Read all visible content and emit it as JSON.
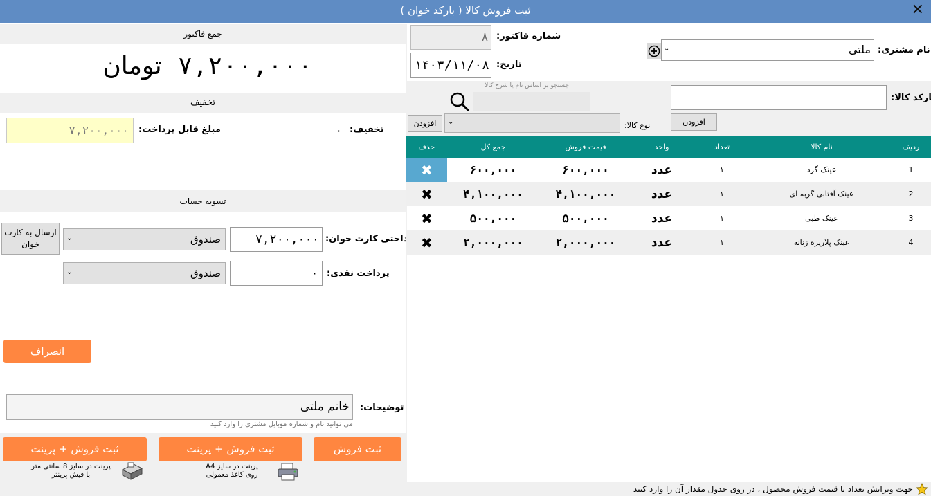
{
  "window": {
    "title": "ثبت فروش کالا ( بارکد خوان )",
    "close_glyph": "✕"
  },
  "invoice": {
    "total_section_title": "جمع فاکتور",
    "total_amount": "۷,۲۰۰,۰۰۰",
    "currency": "تومان",
    "invoice_number_label": "شماره فاکتور:",
    "invoice_number": "۸",
    "date_label": "تاریخ:",
    "date": "۱۴۰۳/۱۱/۰۸"
  },
  "discount": {
    "section_title": "تخفیف",
    "discount_label": "تخفیف:",
    "discount_value": "۰",
    "payable_label": "مبلغ قابل پرداخت:",
    "payable_value": "۷,۲۰۰,۰۰۰"
  },
  "settlement": {
    "section_title": "تسویه حساب",
    "card_label": "پرداختی کارت خوان:",
    "card_value": "۷,۲۰۰,۰۰۰",
    "card_account": "صندوق",
    "send_to_card_reader": "ارسال به کارت خوان",
    "cash_label": "پرداخت نقدی:",
    "cash_value": "۰",
    "cash_account": "صندوق"
  },
  "actions": {
    "cancel": "انصراف",
    "save": "ثبت فروش",
    "save_print_a4": "ثبت فروش + پرینت",
    "save_print_receipt": "ثبت فروش + پرینت",
    "a4_hint_line1": "پرینت در سایز A4",
    "a4_hint_line2": "روی کاغذ معمولی",
    "receipt_hint_line1": "پرینت در سایز 8 سانتی متر",
    "receipt_hint_line2": "با فیش پرینتر"
  },
  "notes": {
    "label": "توضیحات:",
    "value": "خانم ملتی",
    "hint": "می توانید نام و شماره موبایل مشتری را وارد کنید"
  },
  "customer": {
    "label": "نام مشتری:",
    "value": "ملتی"
  },
  "barcode": {
    "label": "بارکد کالا:",
    "value": "",
    "add_button": "افزودن",
    "search_placeholder": "جستجو بر اساس نام یا شرح کالا",
    "category_label": "نوع کالا:",
    "category_value": "",
    "category_add_button": "افزودن"
  },
  "table": {
    "headers": [
      "ردیف",
      "نام کالا",
      "تعداد",
      "واحد",
      "قیمت فروش",
      "جمع کل",
      "حذف"
    ],
    "rows": [
      {
        "row": "1",
        "name": "عینک گرد",
        "qty": "۱",
        "unit": "عدد",
        "price": "۶۰۰,۰۰۰",
        "total": "۶۰۰,۰۰۰",
        "del": "✖"
      },
      {
        "row": "2",
        "name": "عینک آفتابی گربه ای",
        "qty": "۱",
        "unit": "عدد",
        "price": "۴,۱۰۰,۰۰۰",
        "total": "۴,۱۰۰,۰۰۰",
        "del": "✖"
      },
      {
        "row": "3",
        "name": "عینک طبی",
        "qty": "۱",
        "unit": "عدد",
        "price": "۵۰۰,۰۰۰",
        "total": "۵۰۰,۰۰۰",
        "del": "✖"
      },
      {
        "row": "4",
        "name": "عینک پلاریزه زنانه",
        "qty": "۱",
        "unit": "عدد",
        "price": "۲,۰۰۰,۰۰۰",
        "total": "۲,۰۰۰,۰۰۰",
        "del": "✖"
      }
    ]
  },
  "footer": {
    "hint": "جهت ویرایش تعداد یا قیمت فروش محصول ، در روی جدول مقدار آن را وارد کنید"
  },
  "icons": {
    "star": "star-icon",
    "plus": "add-circle-icon",
    "search": "search-icon",
    "printer": "printer-icon"
  },
  "colors": {
    "title_bar": "#5f8cc4",
    "table_header": "#078d86",
    "accent_orange": "#ff8640",
    "highlight_delete": "#58a8d0",
    "payable_bg": "#ffffc8"
  }
}
